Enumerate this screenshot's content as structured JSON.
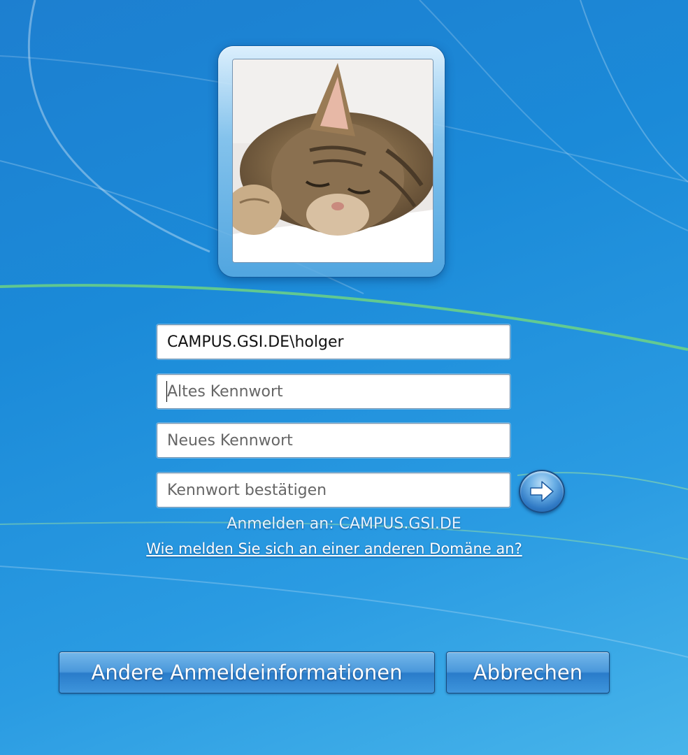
{
  "login": {
    "username_value": "CAMPUS.GSI.DE\\holger",
    "old_password_placeholder": "Altes Kennwort",
    "new_password_placeholder": "Neues Kennwort",
    "confirm_password_placeholder": "Kennwort bestätigen",
    "submit_icon": "arrow-right-icon"
  },
  "domain": {
    "signin_text": "Anmelden an: CAMPUS.GSI.DE",
    "other_domain_link": "Wie melden Sie sich an einer anderen Domäne an?"
  },
  "buttons": {
    "other_credentials": "Andere Anmeldeinformationen",
    "cancel": "Abbrechen"
  },
  "avatar": {
    "icon": "user-picture-kitten"
  },
  "colors": {
    "background": "#1b8ad8",
    "button": "#4a98db"
  }
}
